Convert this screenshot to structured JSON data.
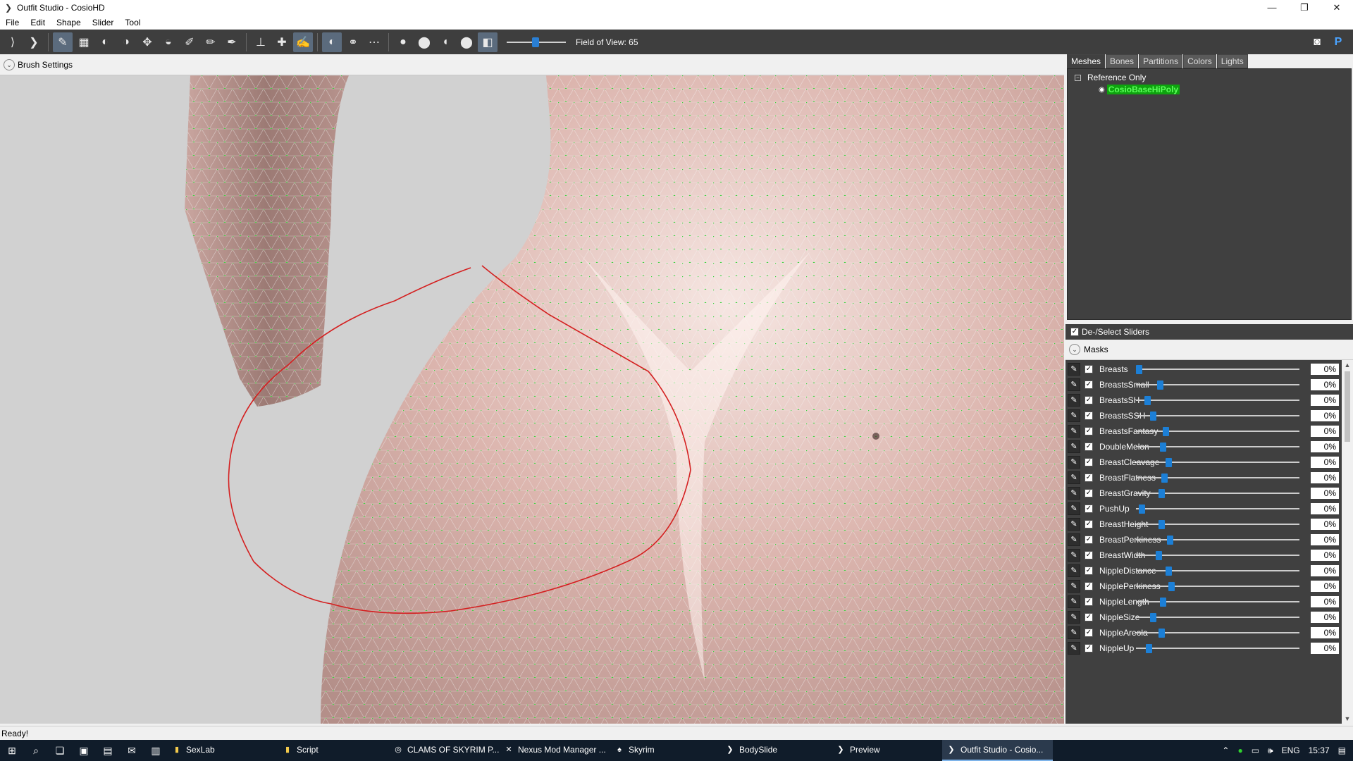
{
  "window": {
    "title": "Outfit Studio - CosioHD"
  },
  "menu": [
    "File",
    "Edit",
    "Shape",
    "Slider",
    "Tool"
  ],
  "toolbar": {
    "fov_label": "Field of View: 65"
  },
  "brush": {
    "label": "Brush Settings"
  },
  "tabs": [
    "Meshes",
    "Bones",
    "Partitions",
    "Colors",
    "Lights"
  ],
  "tree": {
    "root": "Reference Only",
    "mesh": "CosioBaseHiPoly"
  },
  "deselect_label": "De-/Select Sliders",
  "masks_label": "Masks",
  "sliders": [
    {
      "name": "Breasts",
      "value": "0%"
    },
    {
      "name": "BreastsSmall",
      "value": "0%"
    },
    {
      "name": "BreastsSH",
      "value": "0%"
    },
    {
      "name": "BreastsSSH",
      "value": "0%"
    },
    {
      "name": "BreastsFantasy",
      "value": "0%"
    },
    {
      "name": "DoubleMelon",
      "value": "0%"
    },
    {
      "name": "BreastCleavage",
      "value": "0%"
    },
    {
      "name": "BreastFlatness",
      "value": "0%"
    },
    {
      "name": "BreastGravity",
      "value": "0%"
    },
    {
      "name": "PushUp",
      "value": "0%"
    },
    {
      "name": "BreastHeight",
      "value": "0%"
    },
    {
      "name": "BreastPerkiness",
      "value": "0%"
    },
    {
      "name": "BreastWidth",
      "value": "0%"
    },
    {
      "name": "NippleDistance",
      "value": "0%"
    },
    {
      "name": "NipplePerkiness",
      "value": "0%"
    },
    {
      "name": "NippleLength",
      "value": "0%"
    },
    {
      "name": "NippleSize",
      "value": "0%"
    },
    {
      "name": "NippleAreola",
      "value": "0%"
    },
    {
      "name": "NippleUp",
      "value": "0%"
    }
  ],
  "status": "Ready!",
  "taskbar": {
    "apps": [
      "SexLab",
      "Script",
      "CLAMS OF SKYRIM P...",
      "Nexus Mod Manager ...",
      "Skyrim",
      "BodySlide",
      "Preview",
      "Outfit Studio - Cosio..."
    ],
    "language": "ENG",
    "time": "15:37"
  }
}
